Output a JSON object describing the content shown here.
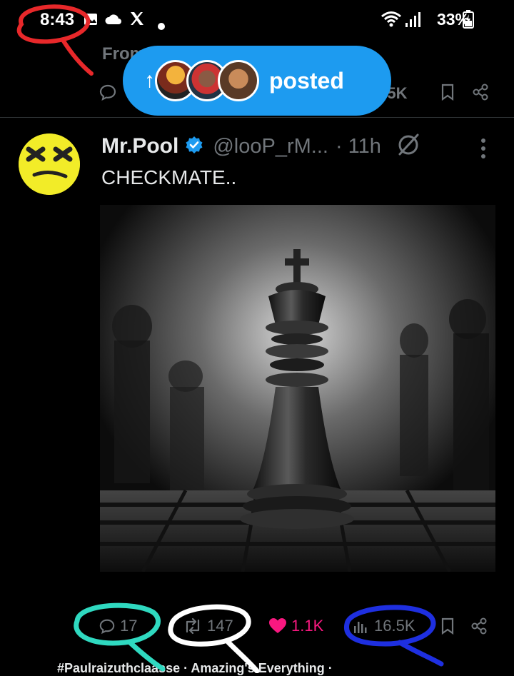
{
  "status_bar": {
    "time": "8:43",
    "battery": "33%",
    "notification_icons": [
      "image-icon",
      "cloud-icon",
      "x-logo-icon",
      "dot-icon"
    ],
    "right_icons": [
      "wifi-icon",
      "signal-icon",
      "battery-icon"
    ]
  },
  "previous_post": {
    "from_label": "From",
    "views": "6.5K"
  },
  "posted_pill": {
    "label": "posted",
    "arrow": "↑"
  },
  "tweet": {
    "display_name": "Mr.Pool",
    "handle": "@looP_rM...",
    "time": "· 11h",
    "text": "CHECKMATE..",
    "replies": "17",
    "reposts": "147",
    "likes": "1.1K",
    "views": "16.5K"
  },
  "bottom_partial": {
    "text": "#Paulraizuthclaasse · Amazing's Everything ·"
  },
  "colors": {
    "accent": "#1d9bf0",
    "like": "#f91880",
    "muted": "#71767b",
    "annot_red": "#e8282a",
    "annot_teal": "#2fd9c0",
    "annot_white": "#ffffff",
    "annot_blue": "#1e2fe0"
  }
}
